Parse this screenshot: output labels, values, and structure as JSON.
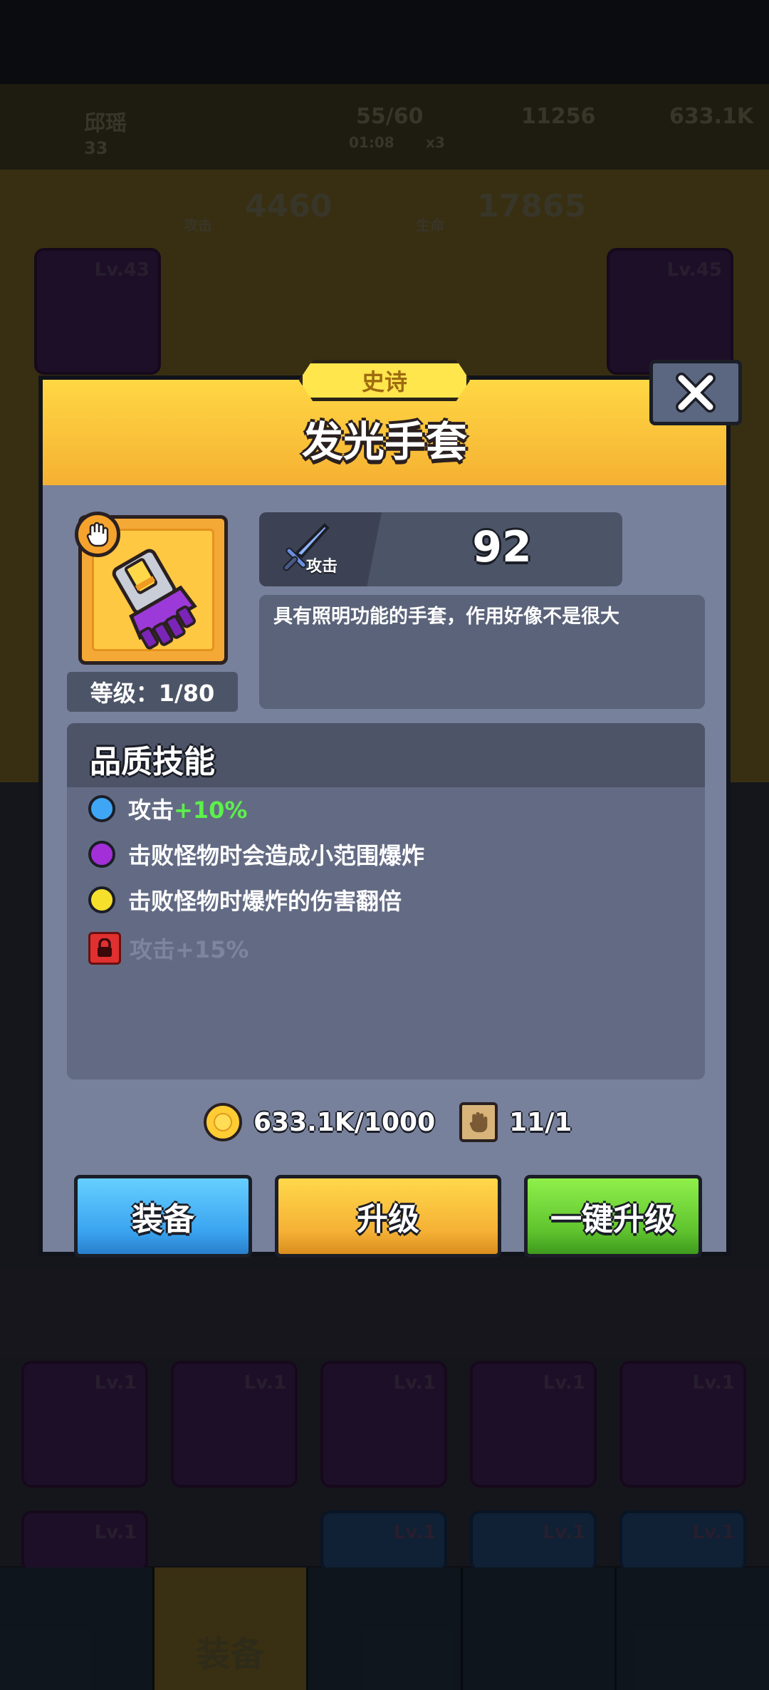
{
  "background": {
    "player_name": "邱瑶",
    "player_level": "33",
    "energy": "55/60",
    "energy_timer": "01:08",
    "energy_multiplier": "x3",
    "gems": "11256",
    "coins": "633.1K",
    "attack_label": "攻击",
    "attack_total": "4460",
    "hp_label": "生命",
    "hp_total": "17865",
    "weapon_level": "Lv.43",
    "armor_level": "Lv.45",
    "inventory_levels": [
      "Lv.1",
      "Lv.1",
      "Lv.1",
      "Lv.1",
      "Lv.1",
      "Lv.1",
      "Lv.1",
      "Lv.1",
      "Lv.1"
    ],
    "nav_active_label": "装备"
  },
  "dialog": {
    "rarity": "史诗",
    "title": "发光手套",
    "level_text": "等级：1/80",
    "stat_label": "攻击",
    "stat_value": "92",
    "description": "具有照明功能的手套，作用好像不是很大",
    "skills_title": "品质技能",
    "skills": [
      {
        "prefix": "攻击",
        "highlight": "+10%",
        "color": "#3fa5f5",
        "locked": false
      },
      {
        "prefix": "击败怪物时会造成小范围爆炸",
        "highlight": "",
        "color": "#a22fd8",
        "locked": false
      },
      {
        "prefix": "击败怪物时爆炸的伤害翻倍",
        "highlight": "",
        "color": "#f7e02c",
        "locked": false
      },
      {
        "prefix": "攻击+15%",
        "highlight": "",
        "color": "#e03030",
        "locked": true
      }
    ],
    "coin_cost": "633.1K/1000",
    "scroll_cost": "11/1",
    "buttons": {
      "equip": "装备",
      "upgrade": "升级",
      "one_click": "一键升级"
    }
  }
}
